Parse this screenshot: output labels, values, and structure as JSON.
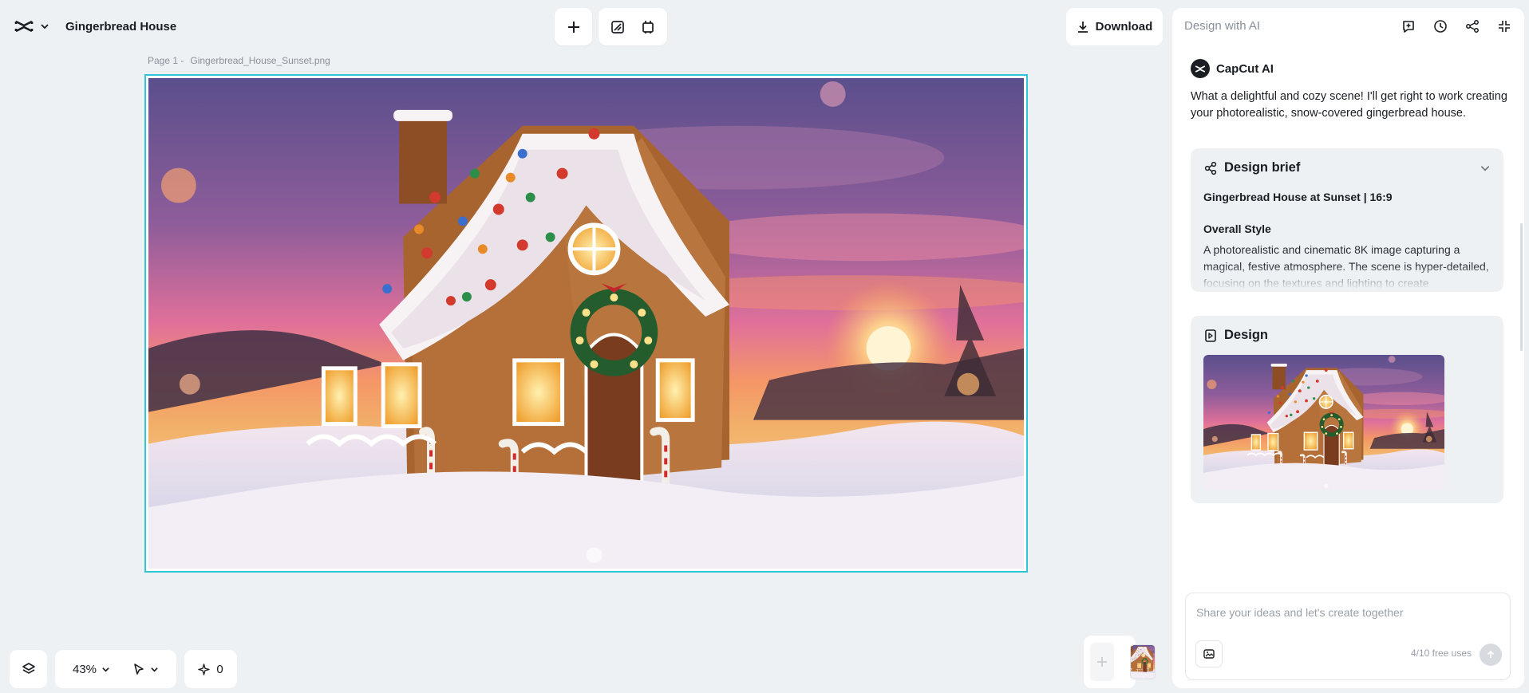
{
  "app": {
    "document_title": "Gingerbread House",
    "logo_icon": "capcut-logo-icon"
  },
  "toolbar": {
    "add_icon": "plus-icon",
    "edit_icon": "edit-square-icon",
    "resize_icon": "resize-canvas-icon",
    "download_label": "Download"
  },
  "canvas": {
    "page_label": "Page 1 -",
    "file_name": "Gingerbread_House_Sunset.png",
    "selection_color": "#2fc6d6"
  },
  "bottom_bar": {
    "layers_icon": "layers-icon",
    "zoom_value": "43%",
    "pointer_icon": "pointer-icon",
    "credits_count": "0",
    "credits_icon": "sparkle-icon"
  },
  "pages": {
    "add_icon": "plus-icon",
    "thumbnail_icon": "page-thumbnail"
  },
  "panel": {
    "title": "Design with AI",
    "header_icons": [
      "new-chat-icon",
      "history-icon",
      "share-icon",
      "collapse-icon"
    ],
    "ai_name": "CapCut AI",
    "ai_message": "What a delightful and cozy scene! I'll get right to work creating your photorealistic, snow-covered gingerbread house.",
    "brief": {
      "title": "Design brief",
      "subtitle": "Gingerbread House at Sunset | 16:9",
      "style_label": "Overall Style",
      "style_text": "A photorealistic and cinematic 8K image capturing a magical, festive atmosphere. The scene is hyper-detailed, focusing on the textures and lighting to create"
    },
    "design": {
      "title": "Design"
    },
    "input": {
      "placeholder": "Share your ideas and let's create together",
      "value": ""
    },
    "free_uses": "4/10 free uses"
  }
}
